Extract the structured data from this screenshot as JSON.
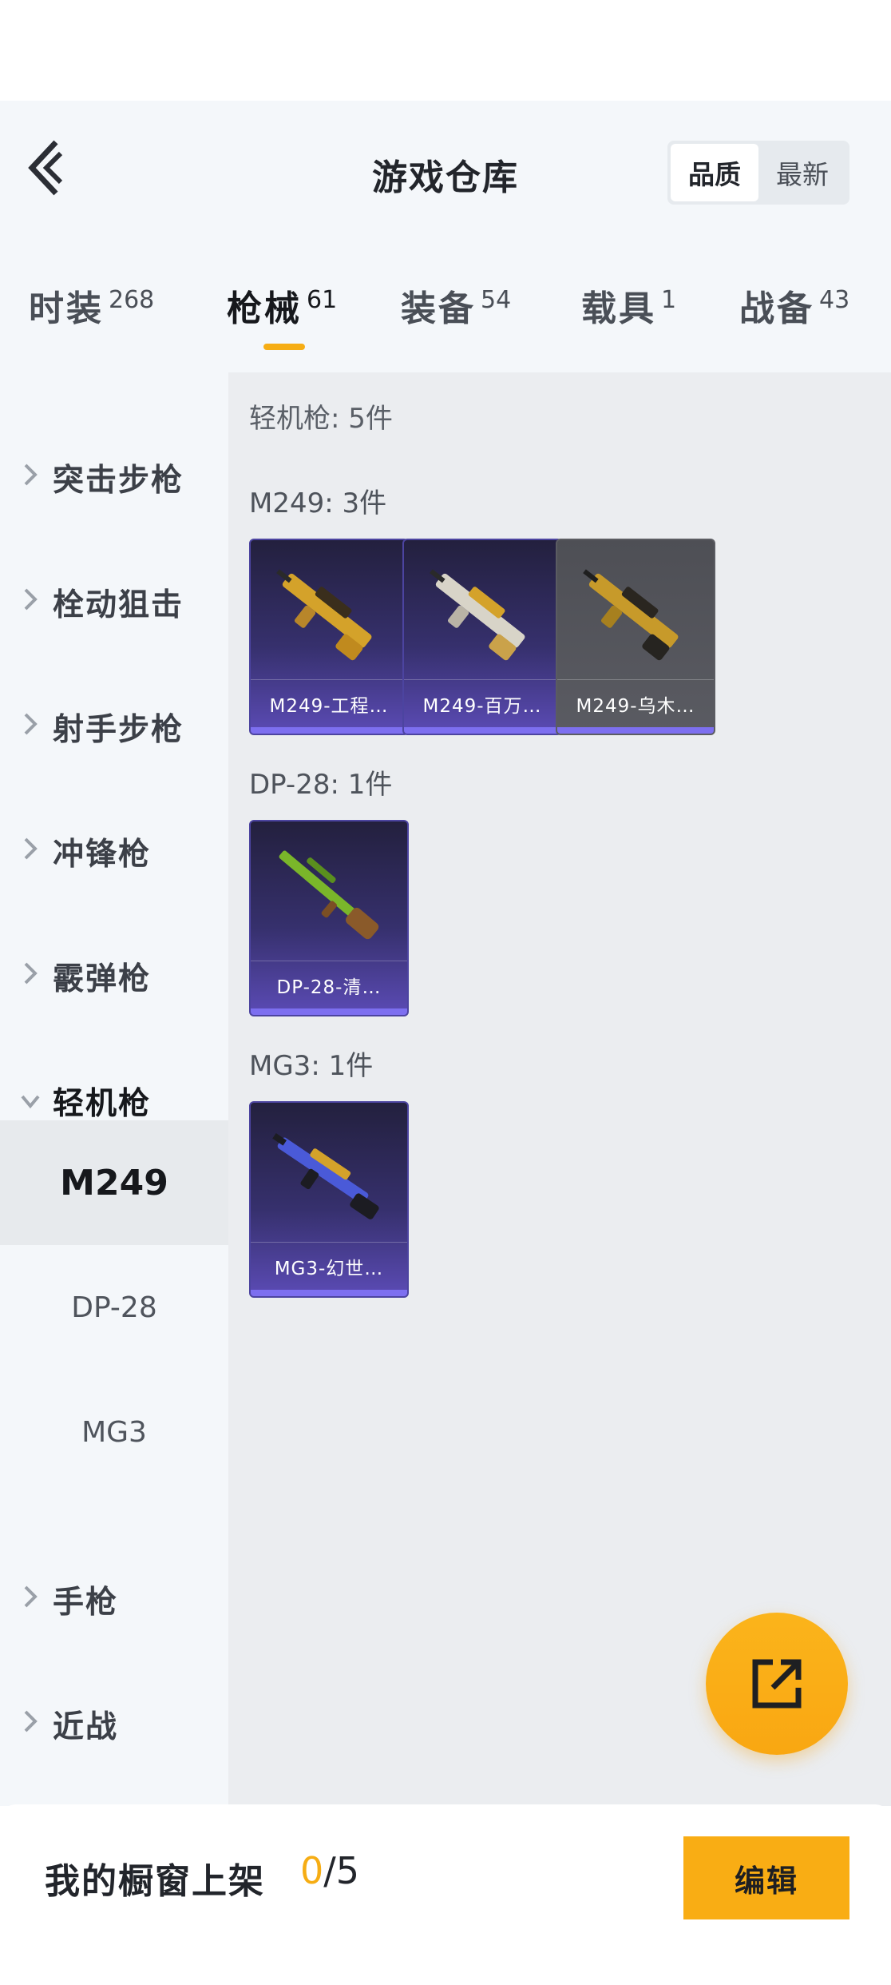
{
  "header": {
    "title": "游戏仓库",
    "sort_options": [
      {
        "label": "品质",
        "active": true
      },
      {
        "label": "最新",
        "active": false
      }
    ]
  },
  "tabs": [
    {
      "name": "时装",
      "count": "268",
      "active": false
    },
    {
      "name": "枪械",
      "count": "61",
      "active": true
    },
    {
      "name": "装备",
      "count": "54",
      "active": false
    },
    {
      "name": "载具",
      "count": "1",
      "active": false
    },
    {
      "name": "战备",
      "count": "43",
      "active": false
    }
  ],
  "sidebar": {
    "categories": [
      {
        "label": "突击步枪",
        "expanded": false
      },
      {
        "label": "栓动狙击",
        "expanded": false
      },
      {
        "label": "射手步枪",
        "expanded": false
      },
      {
        "label": "冲锋枪",
        "expanded": false
      },
      {
        "label": "霰弹枪",
        "expanded": false
      },
      {
        "label": "轻机枪",
        "expanded": true
      },
      {
        "label": "手枪",
        "expanded": false
      },
      {
        "label": "近战",
        "expanded": false
      }
    ],
    "subitems": [
      {
        "label": "M249",
        "active": true
      },
      {
        "label": "DP-28",
        "active": false
      },
      {
        "label": "MG3",
        "active": false
      }
    ]
  },
  "content": {
    "group_title": "轻机枪: 5件",
    "subgroups": [
      {
        "title": "M249: 3件",
        "items": [
          {
            "name": "M249-工程…",
            "rarity": "purple",
            "icon": "m249-gold-icon"
          },
          {
            "name": "M249-百万…",
            "rarity": "purple",
            "icon": "m249-silver-gold-icon"
          },
          {
            "name": "M249-乌木…",
            "rarity": "gray",
            "icon": "m249-ebony-icon"
          }
        ]
      },
      {
        "title": "DP-28: 1件",
        "items": [
          {
            "name": "DP-28-清…",
            "rarity": "purple",
            "icon": "dp28-green-icon"
          }
        ]
      },
      {
        "title": "MG3: 1件",
        "items": [
          {
            "name": "MG3-幻世…",
            "rarity": "purple",
            "icon": "mg3-blue-gold-icon"
          }
        ]
      }
    ]
  },
  "showcase": {
    "label": "我的橱窗上架",
    "current": "0",
    "total": "/5",
    "edit_label": "编辑"
  },
  "colors": {
    "accent": "#F9AD14",
    "rarity_purple": "#7D6FF0",
    "sidebar_bg": "#F4F7FA",
    "content_bg": "#EBEDF0"
  }
}
